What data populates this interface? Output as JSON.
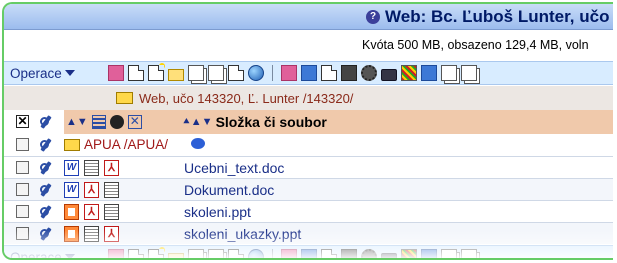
{
  "header": {
    "title": "Web: Bc. Ľuboš Lunter, učo",
    "help_icon": "question-circle-icon",
    "quota": "Kvóta 500 MB, obsazeno 129,4 MB, voln"
  },
  "toolbar": {
    "operations_label": "Operace",
    "icons": [
      "select-all-icon",
      "new-file-icon",
      "new-file-star-icon",
      "new-folder-icon",
      "copy-icon",
      "paste-icon",
      "edit-icon",
      "globe-icon",
      "separator",
      "rights-icon",
      "delete-icon",
      "rename-icon",
      "properties-icon",
      "settings-icon",
      "lock-icon",
      "access-icon",
      "sort-icon",
      "copy-icon",
      "move-icon"
    ]
  },
  "current_folder": {
    "path": "Web, učo 143320, Ľ. Lunter /143320/"
  },
  "table_header": {
    "name_column": "Složka či soubor"
  },
  "subfolder": {
    "label": "APUA /APUA/",
    "icon": "comment-bubble-icon"
  },
  "files": [
    {
      "name": "Ucebni_text.doc",
      "type": "doc",
      "icons": [
        "word-icon",
        "text-icon",
        "pdf-icon"
      ]
    },
    {
      "name": "Dokument.doc",
      "type": "doc",
      "icons": [
        "word-icon",
        "pdf-icon",
        "text-icon"
      ]
    },
    {
      "name": "skoleni.ppt",
      "type": "ppt",
      "icons": [
        "ppt-icon",
        "pdf-icon",
        "text-icon"
      ]
    },
    {
      "name": "skoleni_ukazky.ppt",
      "type": "ppt",
      "icons": [
        "ppt-icon",
        "text-icon",
        "pdf-icon"
      ]
    }
  ],
  "colors": {
    "frame_border": "#66cc66",
    "header_bar": "#9cbcee",
    "toolbar_bg": "#d8ecff",
    "table_header_bg": "#f0c9ab",
    "file_link": "#1a2f88",
    "folder_path": "#8a2a1a"
  }
}
